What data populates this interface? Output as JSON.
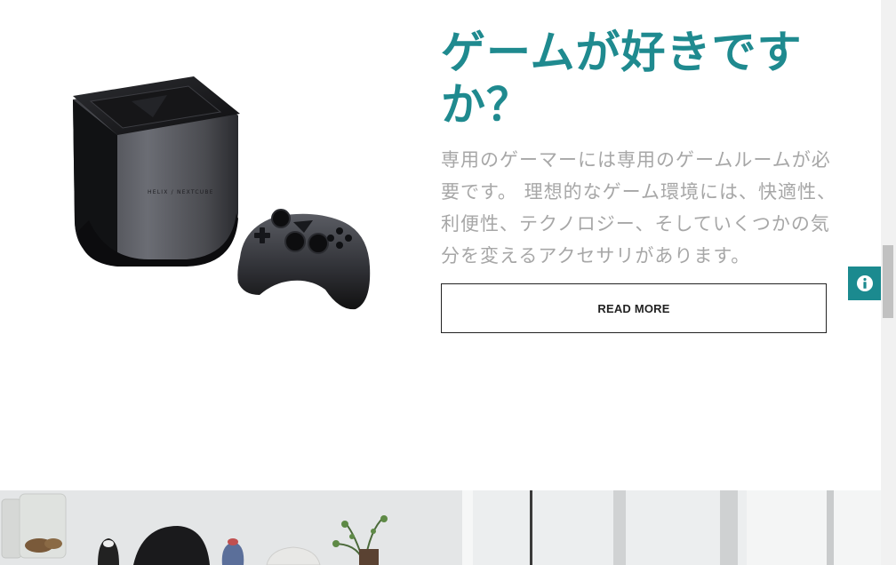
{
  "hero": {
    "headline": "ゲームが好きですか？",
    "body": "専用のゲーマーには専用のゲームルームが必要です。 理想的なゲーム環境には、快適性、利便性、テクノロジー、そしていくつかの気分を変えるアクセサリがあります。",
    "read_more_label": "READ MORE"
  },
  "product": {
    "console_label": "HELIX / NEXTCUBE"
  },
  "info_button": {
    "icon": "info-icon"
  },
  "colors": {
    "accent": "#1f8a8f",
    "body_text": "#a7a7a7",
    "button_border": "#222222"
  }
}
